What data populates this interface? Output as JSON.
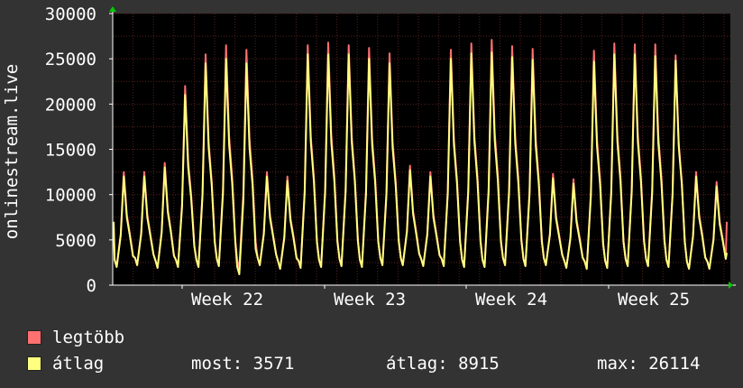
{
  "chart_data": {
    "type": "area",
    "ylabel": "onlinestream.live",
    "ylim": [
      0,
      30000
    ],
    "y_ticks": [
      0,
      5000,
      10000,
      15000,
      20000,
      25000,
      30000
    ],
    "x_ticks": [
      "Week 22",
      "Week 23",
      "Week 24",
      "Week 25"
    ],
    "grid": true,
    "colors": {
      "background": "#333333",
      "plot_bg": "#000000",
      "grid": "#5a2020",
      "axis": "#ffffff",
      "arrow": "#00cc00"
    },
    "series": [
      {
        "name": "legtöbb",
        "color": "#ff7070",
        "daily_peaks": [
          12500,
          12500,
          13500,
          22000,
          25500,
          26500,
          26000,
          12500,
          12000,
          26500,
          26800,
          26500,
          26200,
          25600,
          13200,
          12500,
          26000,
          26700,
          27100,
          26400,
          26100,
          12300,
          11700,
          25900,
          26700,
          26600,
          26600,
          25400,
          12500,
          11400
        ],
        "daily_troughs": [
          2000,
          2200,
          1900,
          2000,
          2000,
          2100,
          1900,
          2200,
          1800,
          1900,
          2000,
          2100,
          2000,
          2200,
          2200,
          2100,
          2100,
          2000,
          2000,
          2200,
          2100,
          2200,
          1900,
          1800,
          1900,
          2100,
          2100,
          2000,
          1800,
          1800
        ]
      },
      {
        "name": "átlag",
        "color": "#ffff80",
        "daily_peaks": [
          12000,
          12000,
          13000,
          21000,
          24500,
          25000,
          24500,
          12000,
          11500,
          25500,
          25500,
          25500,
          25000,
          24500,
          12700,
          12000,
          25000,
          25600,
          25700,
          25200,
          24900,
          11800,
          11200,
          24700,
          25500,
          25500,
          25300,
          24800,
          12000,
          10900
        ],
        "daily_troughs": [
          2000,
          2200,
          1900,
          2000,
          2000,
          2100,
          1200,
          2200,
          1800,
          1900,
          2000,
          2100,
          2000,
          2200,
          2200,
          2100,
          2100,
          2000,
          2000,
          2200,
          2100,
          2200,
          1900,
          1800,
          1900,
          2100,
          2100,
          2000,
          1800,
          1800
        ]
      }
    ],
    "end_values": {
      "max": 7000,
      "avg": 3571
    }
  },
  "legend": {
    "items": [
      {
        "label": "legtöbb",
        "color": "#ff7070"
      },
      {
        "label": "átlag",
        "color": "#ffff80"
      }
    ],
    "stats": {
      "now": "most: 3571",
      "avg": "átlag: 8915",
      "max": "max: 26114"
    }
  }
}
